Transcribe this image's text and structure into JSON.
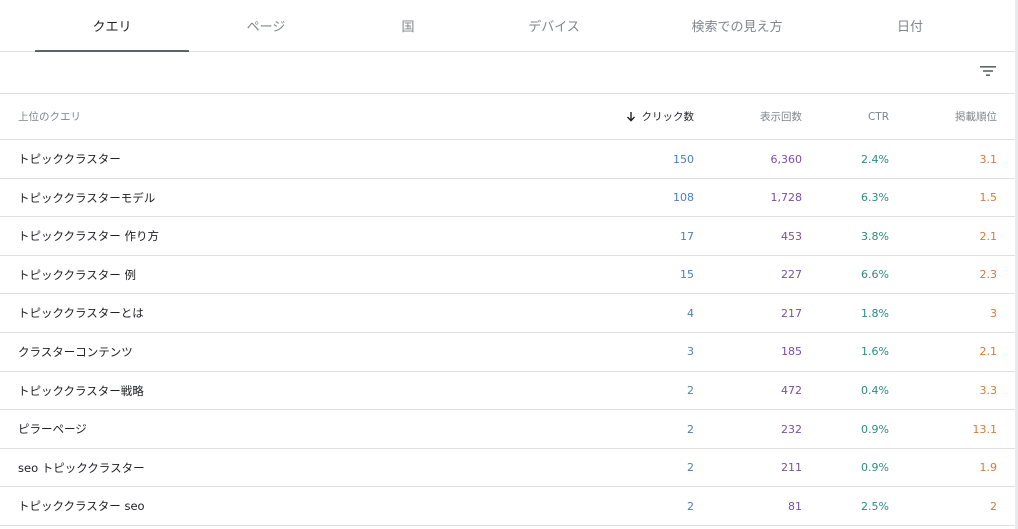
{
  "tabs": [
    {
      "label": "クエリ",
      "active": true
    },
    {
      "label": "ページ",
      "active": false
    },
    {
      "label": "国",
      "active": false
    },
    {
      "label": "デバイス",
      "active": false
    },
    {
      "label": "検索での見え方",
      "active": false
    },
    {
      "label": "日付",
      "active": false
    }
  ],
  "filter": {
    "icon": "filter-icon"
  },
  "table": {
    "headers": {
      "query": "上位のクエリ",
      "clicks": "クリック数",
      "impressions": "表示回数",
      "ctr": "CTR",
      "position": "掲載順位"
    },
    "sort_icon": "arrow-down-icon",
    "rows": [
      {
        "query": "トピッククラスター",
        "clicks": "150",
        "impressions": "6,360",
        "ctr": "2.4%",
        "position": "3.1"
      },
      {
        "query": "トピッククラスターモデル",
        "clicks": "108",
        "impressions": "1,728",
        "ctr": "6.3%",
        "position": "1.5"
      },
      {
        "query": "トピッククラスター 作り方",
        "clicks": "17",
        "impressions": "453",
        "ctr": "3.8%",
        "position": "2.1"
      },
      {
        "query": "トピッククラスター 例",
        "clicks": "15",
        "impressions": "227",
        "ctr": "6.6%",
        "position": "2.3"
      },
      {
        "query": "トピッククラスターとは",
        "clicks": "4",
        "impressions": "217",
        "ctr": "1.8%",
        "position": "3"
      },
      {
        "query": "クラスターコンテンツ",
        "clicks": "3",
        "impressions": "185",
        "ctr": "1.6%",
        "position": "2.1"
      },
      {
        "query": "トピッククラスター戦略",
        "clicks": "2",
        "impressions": "472",
        "ctr": "0.4%",
        "position": "3.3"
      },
      {
        "query": "ピラーページ",
        "clicks": "2",
        "impressions": "232",
        "ctr": "0.9%",
        "position": "13.1"
      },
      {
        "query": "seo トピッククラスター",
        "clicks": "2",
        "impressions": "211",
        "ctr": "0.9%",
        "position": "1.9"
      },
      {
        "query": "トピッククラスター seo",
        "clicks": "2",
        "impressions": "81",
        "ctr": "2.5%",
        "position": "2"
      }
    ]
  },
  "colors": {
    "clicks": "#4a7fc0",
    "impressions": "#7b4ea0",
    "ctr": "#2e8b82",
    "position": "#d67a38"
  }
}
